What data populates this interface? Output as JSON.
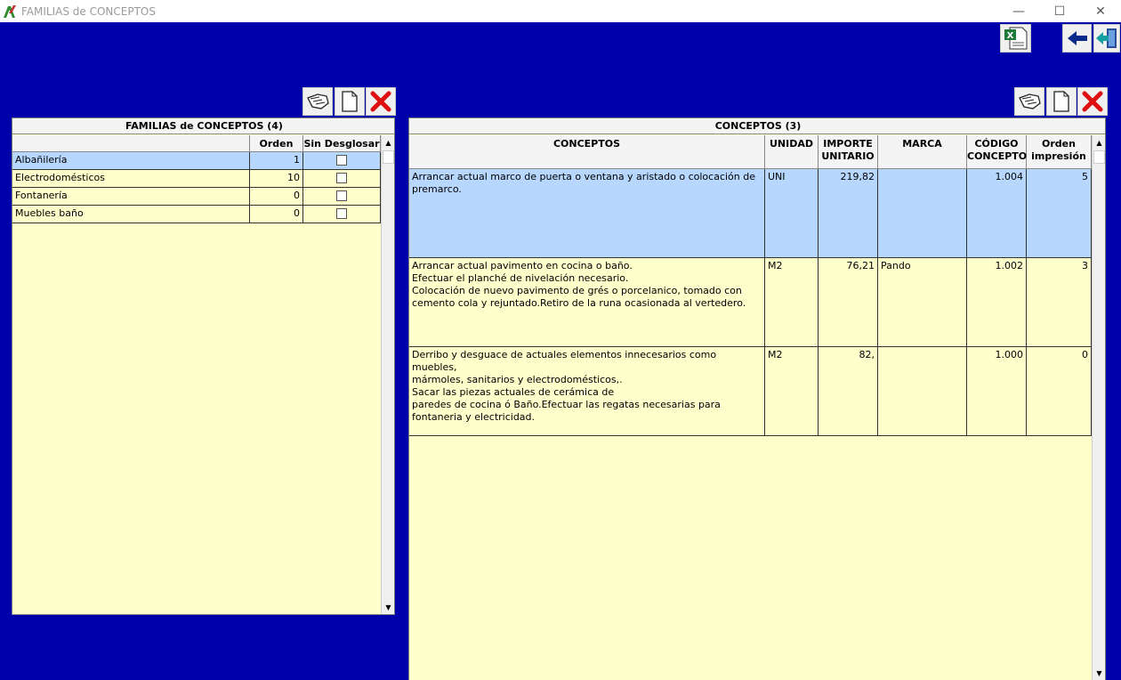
{
  "window": {
    "title": "FAMILIAS  de  CONCEPTOS",
    "min_glyph": "—",
    "max_glyph": "☐",
    "close_glyph": "✕"
  },
  "colors": {
    "background": "#0000aa",
    "row_bg": "#ffffcc",
    "selected_row": "#b7d7ff",
    "delete_red": "#e11010"
  },
  "toolbar_top": [
    "excel-export-icon",
    "back-arrow-icon",
    "exit-door-icon"
  ],
  "panel_tools": [
    "edit-hand-icon",
    "new-document-icon",
    "delete-x-icon"
  ],
  "families": {
    "title": "FAMILIAS  de  CONCEPTOS  (4)",
    "headers": {
      "name": "",
      "orden": "Orden",
      "sin": "Sin Desglosar"
    },
    "rows": [
      {
        "name": "Albañilería",
        "orden": "1",
        "sin": false,
        "selected": true
      },
      {
        "name": "Electrodomésticos",
        "orden": "10",
        "sin": false
      },
      {
        "name": "Fontanería",
        "orden": "0",
        "sin": false
      },
      {
        "name": "Muebles baño",
        "orden": "0",
        "sin": false
      }
    ]
  },
  "concepts": {
    "title": "CONCEPTOS  (3)",
    "headers": {
      "concepto": "CONCEPTOS",
      "unidad": "UNIDAD",
      "importe": "IMPORTE\nUNITARIO",
      "marca": "MARCA",
      "codigo": "CÓDIGO\nCONCEPTO",
      "orden": "Orden\nimpresión"
    },
    "rows": [
      {
        "concepto": "Arrancar actual marco de puerta o ventana y aristado o colocación de\npremarco.",
        "unidad": "UNI",
        "importe": "219,82",
        "marca": "",
        "codigo": "1.004",
        "orden": "5",
        "selected": true
      },
      {
        "concepto": "Arrancar actual pavimento en cocina o baño.\nEfectuar el planché de nivelación necesario.\nColocación de nuevo pavimento de grés o porcelanico, tomado con\ncemento cola y rejuntado.Retiro de la runa ocasionada al vertedero.",
        "unidad": "M2",
        "importe": "76,21",
        "marca": "Pando",
        "codigo": "1.002",
        "orden": "3"
      },
      {
        "concepto": "Derribo y desguace de actuales elementos innecesarios como muebles,\nmármoles, sanitarios y electrodomésticos,.\nSacar las piezas actuales de cerámica de\nparedes de cocina ó Baño.Efectuar las regatas necesarias para\nfontaneria y electricidad.",
        "unidad": "M2",
        "importe": "82,",
        "marca": "",
        "codigo": "1.000",
        "orden": "0"
      }
    ]
  }
}
